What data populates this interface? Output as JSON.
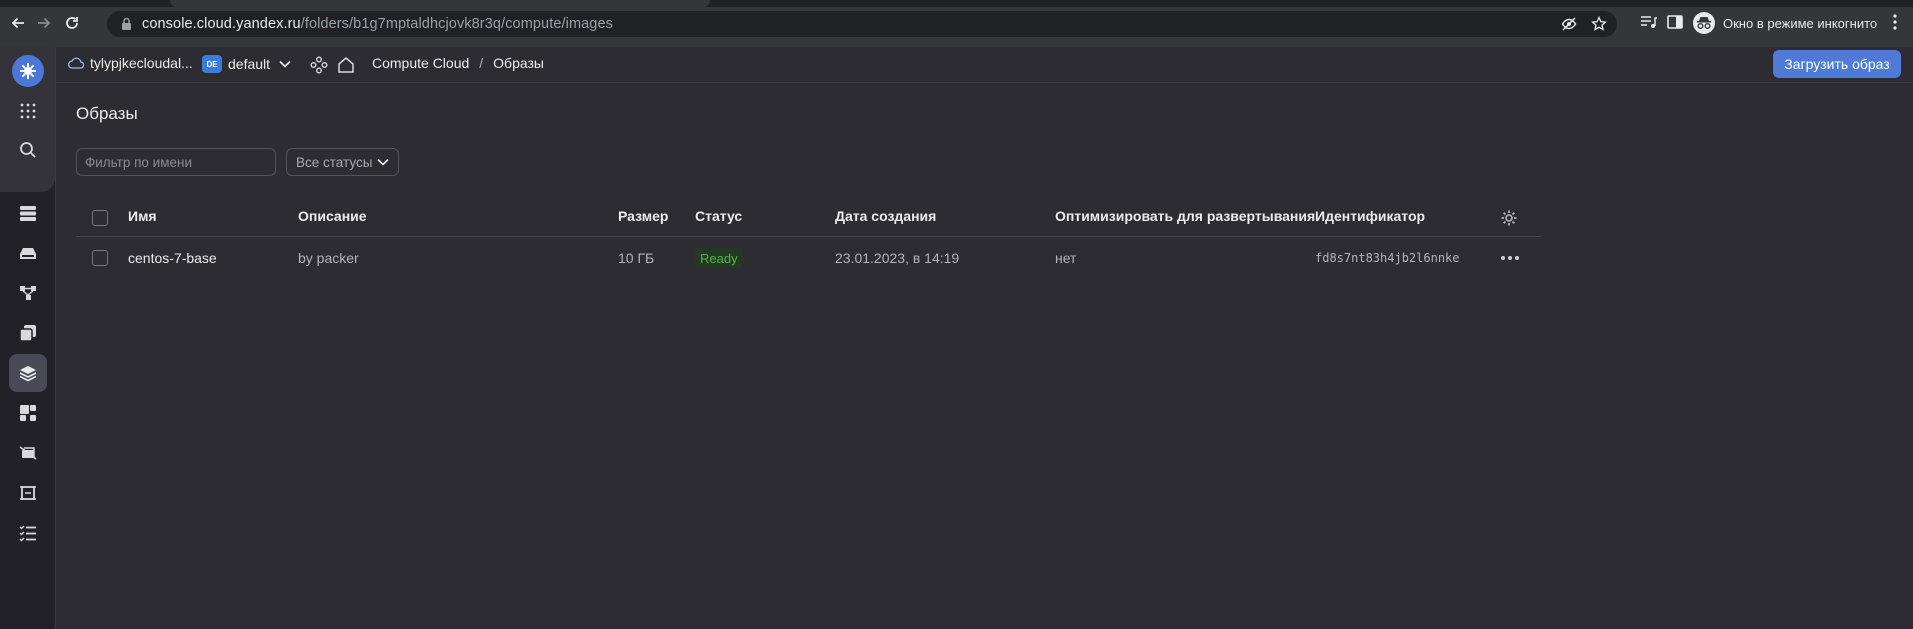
{
  "browser": {
    "url_host": "console.cloud.yandex.ru",
    "url_path": "/folders/b1g7mptaldhcjovk8r3q/compute/images",
    "incognito_label": "Окно в режиме инкогнито"
  },
  "header": {
    "cloud_name": "tylypjkecloudal...",
    "folder_badge": "DE",
    "folder_name": "default",
    "breadcrumb_service": "Compute Cloud",
    "breadcrumb_separator": "/",
    "breadcrumb_current": "Образы",
    "upload_button": "Загрузить образ"
  },
  "sidebar": {
    "items": [
      {
        "icon": "yandex-cloud-logo-icon"
      },
      {
        "icon": "all-services-grid-icon"
      },
      {
        "icon": "search-icon"
      },
      {
        "icon": "virtual-machines-icon"
      },
      {
        "icon": "disks-icon"
      },
      {
        "icon": "placement-groups-icon"
      },
      {
        "icon": "snapshots-icon"
      },
      {
        "icon": "images-icon",
        "active": true
      },
      {
        "icon": "instance-groups-icon"
      },
      {
        "icon": "gpu-clusters-icon"
      },
      {
        "icon": "dedicated-hosts-icon"
      },
      {
        "icon": "operations-icon"
      }
    ]
  },
  "page": {
    "title": "Образы",
    "filter_placeholder": "Фильтр по имени",
    "status_filter": "Все статусы"
  },
  "table": {
    "columns": {
      "name": "Имя",
      "description": "Описание",
      "size": "Размер",
      "status": "Статус",
      "created": "Дата создания",
      "optimize": "Оптимизировать для развертывания",
      "id": "Идентификатор"
    },
    "rows": [
      {
        "name": "centos-7-base",
        "description": "by packer",
        "size": "10 ГБ",
        "status": "Ready",
        "created": "23.01.2023, в 14:19",
        "optimize": "нет",
        "id": "fd8s7nt83h4jb2l6nnke"
      }
    ]
  },
  "colors": {
    "background": "#2d2c33",
    "accent": "#4f7bd6",
    "status_ready": "#4fb24a"
  }
}
